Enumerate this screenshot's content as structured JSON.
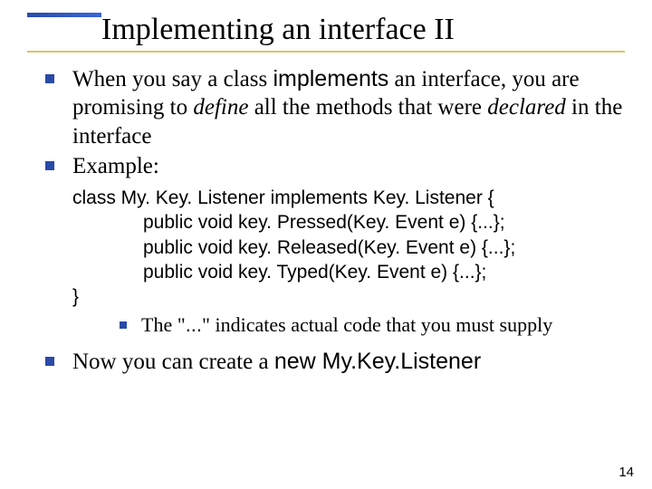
{
  "title": "Implementing an interface II",
  "bullets": {
    "b1_pre": "When you say a class ",
    "b1_kw": "implements",
    "b1_mid1": " an interface, you are promising to ",
    "b1_define": "define",
    "b1_mid2": " all the methods that were ",
    "b1_declared": "declared",
    "b1_post": " in the interface",
    "b2": "Example:",
    "b3_pre": "Now you can create a ",
    "b3_code": "new My.Key.Listener"
  },
  "code": {
    "l1": "class My. Key. Listener implements Key. Listener {",
    "l2": "public void key. Pressed(Key. Event e) {...};",
    "l3": "public void key. Released(Key. Event e) {...};",
    "l4": "public void key. Typed(Key. Event e) {...};",
    "l5": "}"
  },
  "sub": {
    "pre": "The \"",
    "dots": "...",
    "post": "\" indicates actual code that you must supply"
  },
  "page": "14"
}
